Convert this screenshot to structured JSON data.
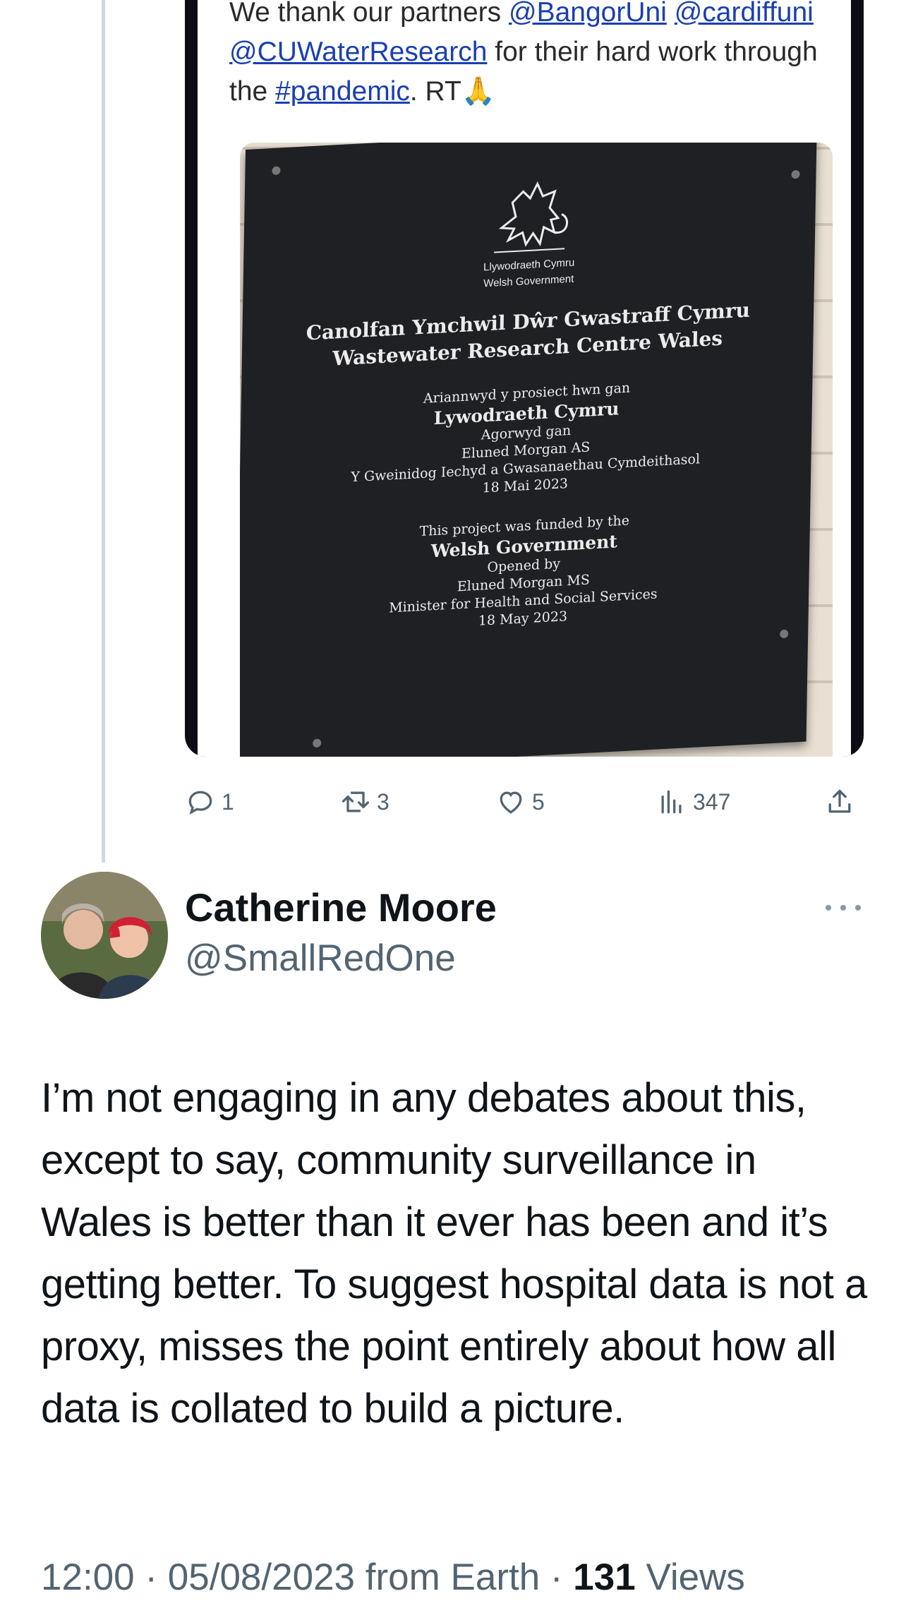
{
  "quoted_tweet": {
    "text_parts": [
      {
        "t": "We thank our partners ",
        "link": false
      },
      {
        "t": "@BangorUni",
        "link": true
      },
      {
        "t": " ",
        "link": false
      },
      {
        "t": "@cardiffuni",
        "link": true
      },
      {
        "t": " ",
        "link": false
      },
      {
        "t": "@CUWaterResearch",
        "link": true
      },
      {
        "t": " for their hard work through the ",
        "link": false
      },
      {
        "t": "#pandemic",
        "link": true
      },
      {
        "t": ". RT🙏",
        "link": false
      }
    ],
    "plaque": {
      "logo_text_1": "Llywodraeth Cymru",
      "logo_text_2": "Welsh Government",
      "title_cy": "Canolfan Ymchwil Dŵr Gwastraff Cymru",
      "title_en": "Wastewater Research Centre Wales",
      "cy_1": "Ariannwyd y prosiect hwn gan",
      "cy_2": "Lywodraeth Cymru",
      "cy_3": "Agorwyd gan",
      "cy_4": "Eluned Morgan AS",
      "cy_5": "Y Gweinidog Iechyd a Gwasanaethau Cymdeithasol",
      "cy_6": "18 Mai 2023",
      "en_1": "This project was funded by the",
      "en_2": "Welsh Government",
      "en_3": "Opened by",
      "en_4": "Eluned Morgan MS",
      "en_5": "Minister for Health and Social Services",
      "en_6": "18 May 2023"
    }
  },
  "actions": {
    "replies": "1",
    "retweets": "3",
    "likes": "5",
    "views": "347"
  },
  "tweet": {
    "name": "Catherine Moore",
    "handle": "@SmallRedOne",
    "text": "I’m not engaging in any debates about this, except to say, community surveillance in Wales is better than it ever has been and it’s getting better. To suggest hospital data is not a proxy, misses the point entirely about how all data is collated to build a picture.",
    "time": "12:00",
    "date": "05/08/2023",
    "source": "from Earth",
    "views_count": "131",
    "views_label": "Views",
    "sep": "·"
  },
  "colors": {
    "text": "#0f1419",
    "secondary": "#536471",
    "link": "#1a3fb0",
    "thread_line": "#cfd9de"
  },
  "icons": [
    "reply-icon",
    "retweet-icon",
    "like-icon",
    "views-icon",
    "share-icon",
    "more-icon"
  ]
}
